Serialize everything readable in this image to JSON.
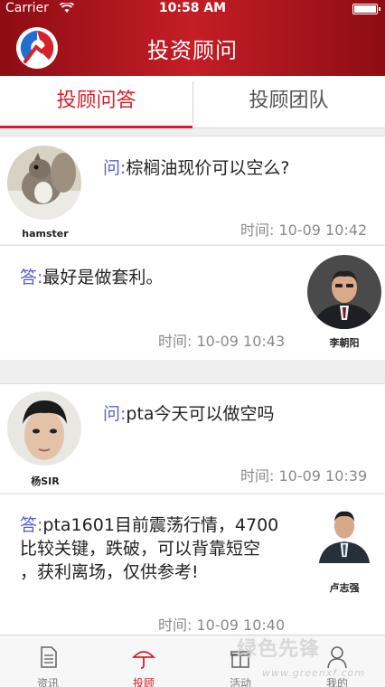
{
  "status_bar": {
    "carrier": "Carrier",
    "time": "10:58 AM"
  },
  "header": {
    "title": "投资顾问"
  },
  "tabs": [
    {
      "label": "投顾问答",
      "active": true
    },
    {
      "label": "投顾团队",
      "active": false
    }
  ],
  "conversations": [
    {
      "question": {
        "user": "hamster",
        "prefix": "问:",
        "text": "棕榈油现价可以空么?",
        "time": "时间: 10-09 10:42"
      },
      "answer": {
        "advisor": "李朝阳",
        "prefix": "答:",
        "text": "最好是做套利。",
        "time": "时间: 10-09 10:43"
      }
    },
    {
      "question": {
        "user": "杨SIR",
        "prefix": "问:",
        "text": "pta今天可以做空吗",
        "time": "时间: 10-09 10:39"
      },
      "answer": {
        "advisor": "卢志强",
        "prefix": "答:",
        "text_lines": [
          "pta1601目前震荡行情，4700",
          "比较关键，跌破，可以背靠短空",
          "，获利离场，仅供参考!"
        ],
        "time": "时间: 10-09 10:40"
      }
    }
  ],
  "tab_bar": {
    "items": [
      {
        "label": "资讯",
        "icon": "document-icon"
      },
      {
        "label": "投顾",
        "icon": "umbrella-icon",
        "active": true
      },
      {
        "label": "活动",
        "icon": "gift-icon"
      },
      {
        "label": "我的",
        "icon": "user-icon"
      }
    ]
  },
  "watermark": {
    "text": "绿色先锋",
    "url": "www.greenxf.com"
  },
  "colors": {
    "brand_red": "#c41e26",
    "accent_red": "#d6202a",
    "prefix_blue": "#5b5bd6"
  }
}
